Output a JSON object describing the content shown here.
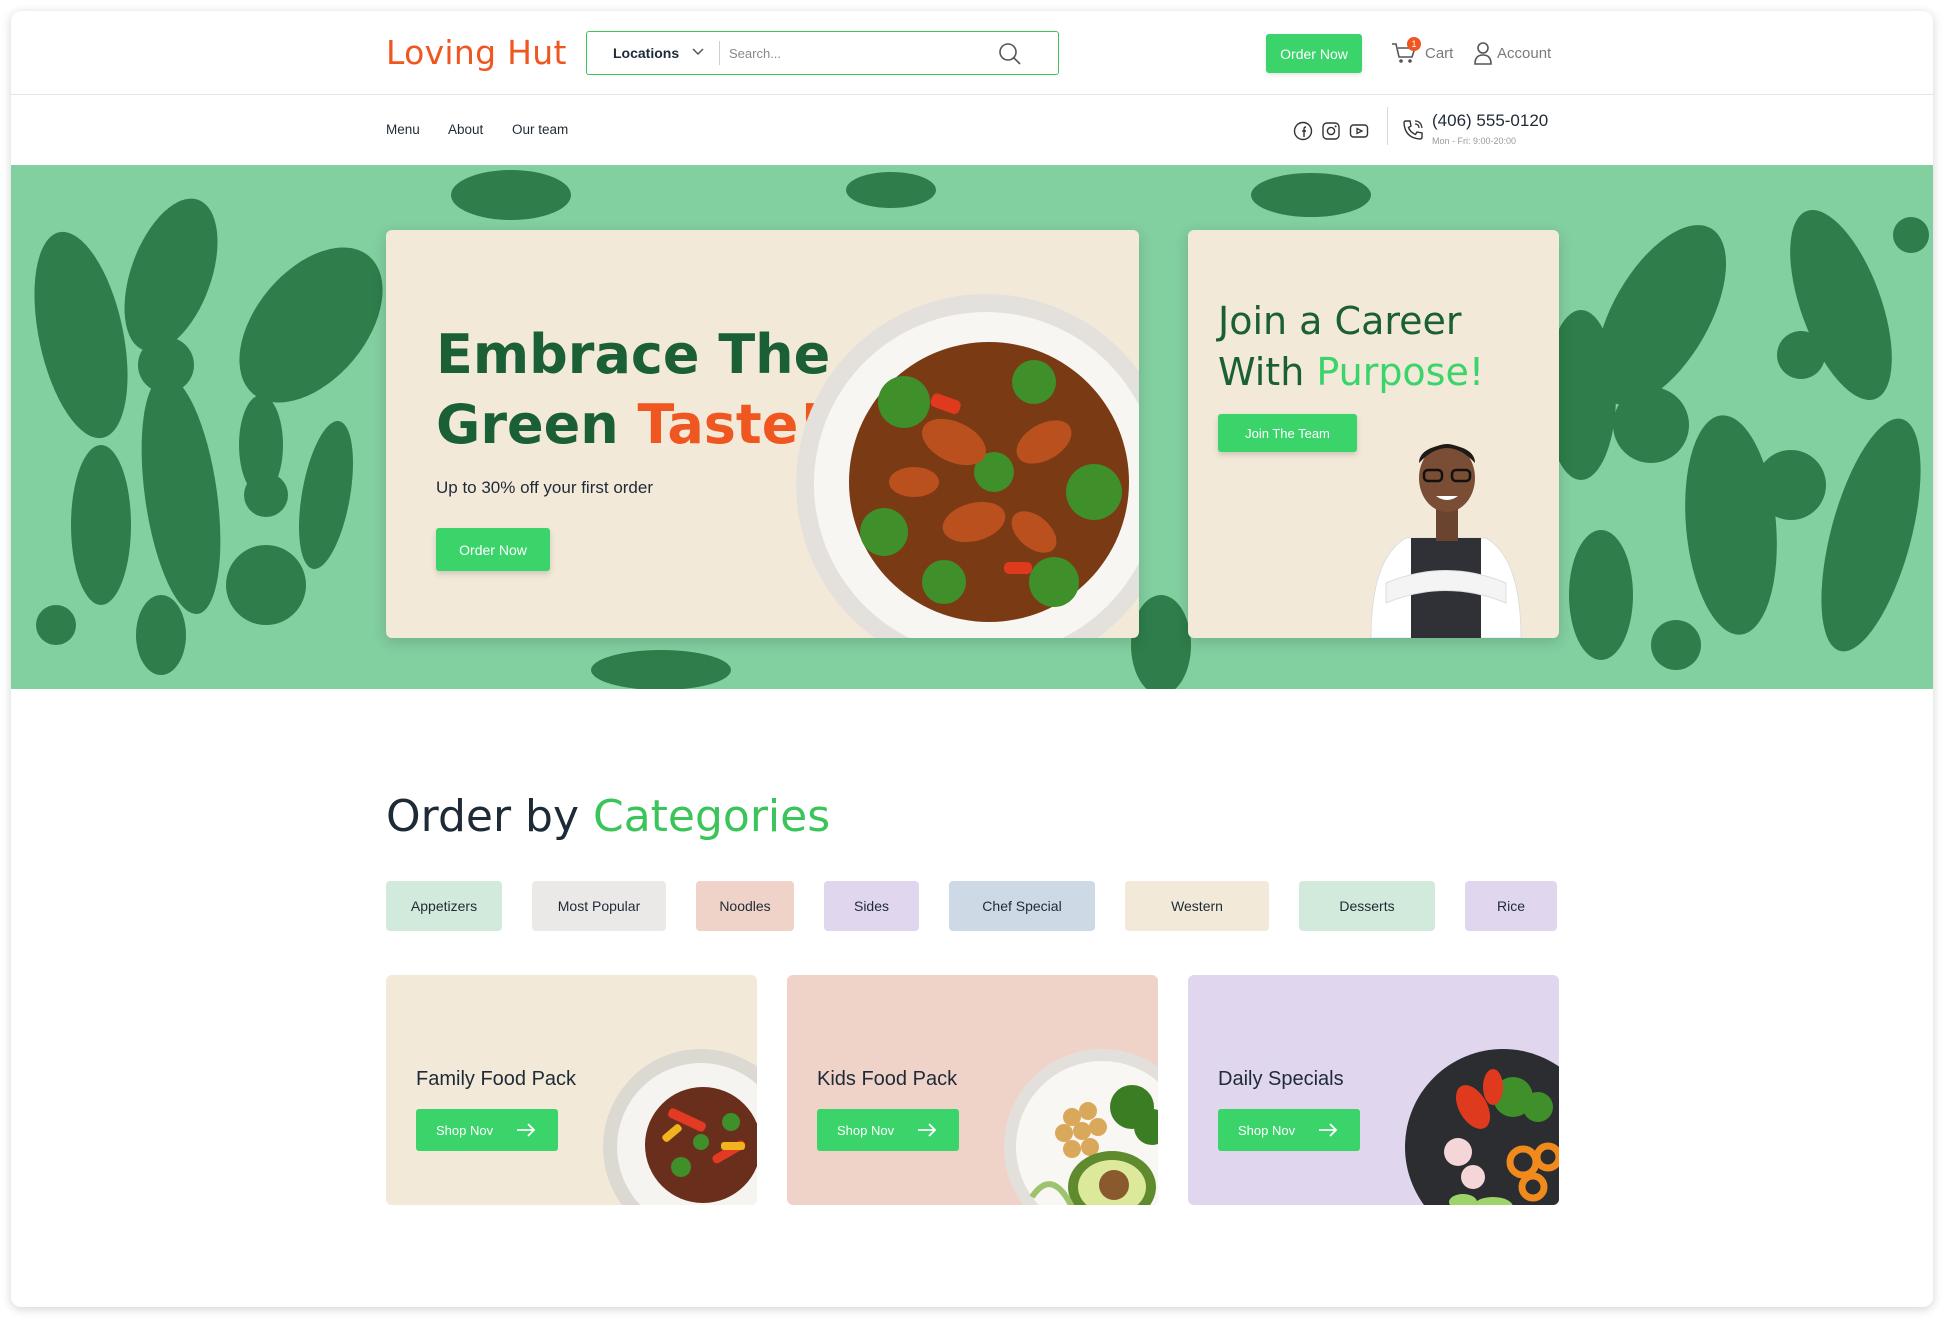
{
  "header": {
    "logo": "Loving Hut",
    "locations_label": "Locations",
    "search_placeholder": "Search...",
    "order_now": "Order Now",
    "cart_label": "Cart",
    "cart_count": "1",
    "account_label": "Account"
  },
  "nav": {
    "items": [
      "Menu",
      "About",
      "Our team"
    ],
    "social_icons": [
      "facebook-icon",
      "instagram-icon",
      "youtube-icon"
    ],
    "phone": "(406) 555-0120",
    "hours": "Mon - Fri: 9:00-20:00"
  },
  "hero": {
    "promo_title_line1": "Embrace The",
    "promo_title_line2_a": "Green ",
    "promo_title_line2_b": "Taste!",
    "promo_subtitle": "Up to 30% off your first order",
    "promo_button": "Order Now",
    "career_title_line1": "Join a Career",
    "career_title_line2_a": "With ",
    "career_title_line2_b": "Purpose!",
    "career_button": "Join The Team"
  },
  "categories": {
    "heading_a": "Order by ",
    "heading_b": "Categories",
    "chips": [
      "Appetizers",
      "Most Popular",
      "Noodles",
      "Sides",
      "Chef Special",
      "Western",
      "Desserts",
      "Rice"
    ]
  },
  "cards": [
    {
      "title": "Family Food Pack",
      "button": "Shop Nov"
    },
    {
      "title": "Kids Food Pack",
      "button": "Shop Nov"
    },
    {
      "title": "Daily Specials",
      "button": "Shop Nov"
    }
  ],
  "colors": {
    "brand_orange": "#f0561f",
    "brand_green": "#3bd46a",
    "dark_green": "#1a5f35",
    "hero_bg": "#82cfa0",
    "card_cream": "#f2e9d8",
    "card_pink": "#efd3c8",
    "card_lavender": "#e0d6ee"
  }
}
